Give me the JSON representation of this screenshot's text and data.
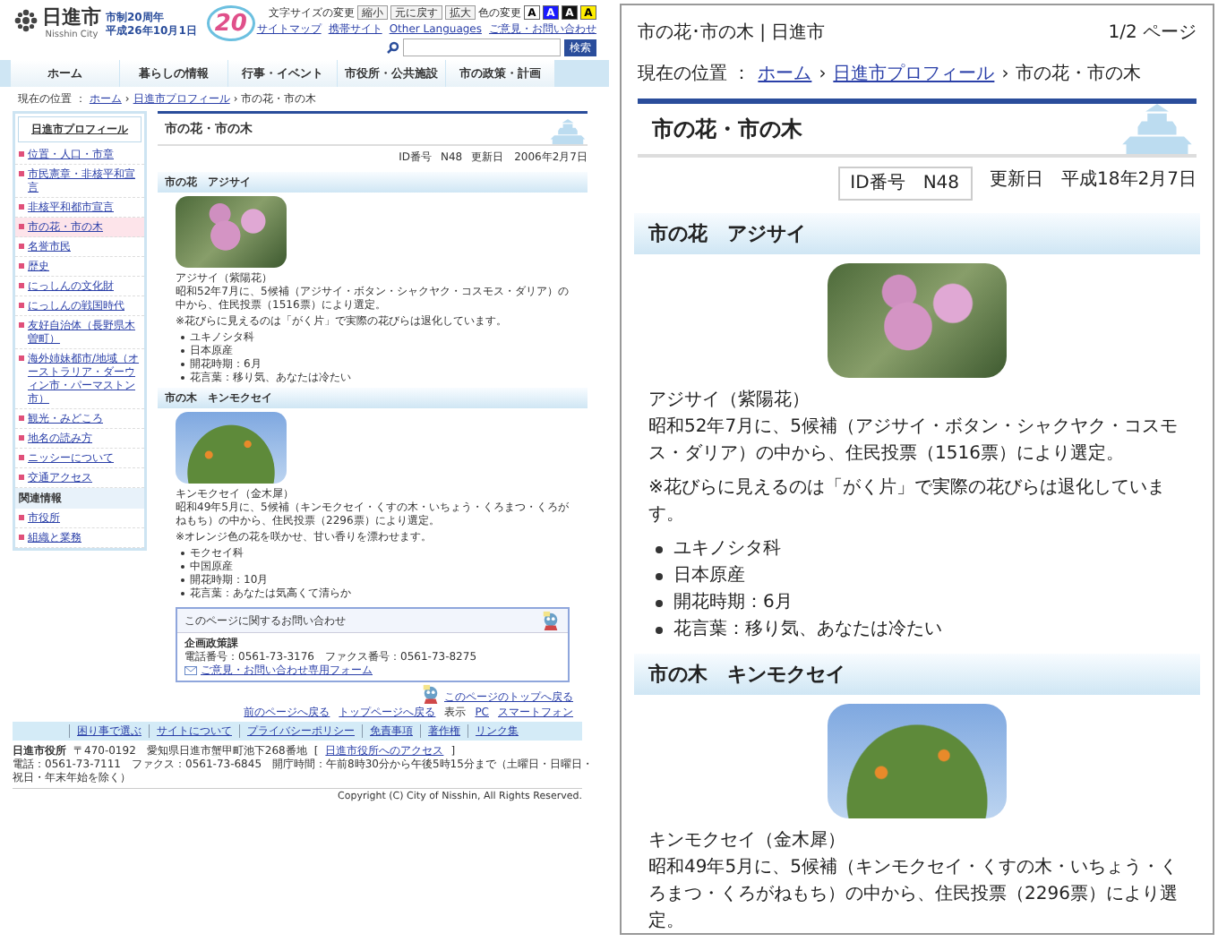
{
  "web_page": {
    "header": {
      "logo": "日進市",
      "logo_sub": "Nisshin City",
      "anniversary": [
        "市制20周年",
        "平成26年10月1日"
      ],
      "anniversary_mark": "20",
      "font_size_label": "文字サイズの変更",
      "font_size_buttons": [
        "縮小",
        "元に戻す",
        "拡大"
      ],
      "color_label": "色の変更",
      "color_buttons": [
        {
          "label": "A",
          "color": "#ffffff"
        },
        {
          "label": "A",
          "color": "#1a1aff"
        },
        {
          "label": "A",
          "color": "#111111"
        },
        {
          "label": "A",
          "color": "#ffee00"
        }
      ],
      "links": [
        "サイトマップ",
        "携帯サイト",
        "Other Languages",
        "ご意見・お問い合わせ"
      ],
      "search_button": "検索"
    },
    "nav": [
      "ホーム",
      "暮らしの情報",
      "行事・イベント",
      "市役所・公共施設",
      "市の政策・計画"
    ],
    "breadcrumb": {
      "label": "現在の位置 ：",
      "links": [
        "ホーム",
        "日進市プロフィール"
      ],
      "separator": "›",
      "current": "市の花・市の木"
    },
    "sidebar": {
      "title": "日進市プロフィール",
      "items": [
        {
          "label": "位置・人口・市章",
          "selected": false
        },
        {
          "label": "市民憲章・非核平和宣言",
          "selected": false
        },
        {
          "label": "非核平和都市宣言",
          "selected": false
        },
        {
          "label": "市の花・市の木",
          "selected": true
        },
        {
          "label": "名誉市民",
          "selected": false
        },
        {
          "label": "歴史",
          "selected": false
        },
        {
          "label": "にっしんの文化財",
          "selected": false
        },
        {
          "label": "にっしんの戦国時代",
          "selected": false
        },
        {
          "label": "友好自治体（長野県木曽町）",
          "selected": false
        },
        {
          "label": "海外姉妹都市/地域（オーストラリア・ダーウィン市・パーマストン市）",
          "selected": false
        },
        {
          "label": "観光・みどころ",
          "selected": false
        },
        {
          "label": "地名の読み方",
          "selected": false
        },
        {
          "label": "ニッシーについて",
          "selected": false
        },
        {
          "label": "交通アクセス",
          "selected": false
        }
      ],
      "related_title": "関連情報",
      "related_items": [
        "市役所",
        "組織と業務"
      ]
    },
    "article": {
      "title": "市の花・市の木",
      "id_label": "ID番号",
      "id": "N48",
      "updated_label": "更新日",
      "updated": "2006年2月7日",
      "sections": [
        {
          "heading": "市の花　アジサイ",
          "photo": {
            "kind": "flower"
          },
          "caption": "アジサイ（紫陽花）",
          "paragraph": "昭和52年7月に、5候補（アジサイ・ボタン・シャクヤク・コスモス・ダリア）の中から、住民投票（1516票）により選定。",
          "note": "※花びらに見えるのは「がく片」で実際の花びらは退化しています。",
          "bullets": [
            "ユキノシタ科",
            "日本原産",
            "開花時期：6月",
            "花言葉：移り気、あなたは冷たい"
          ]
        },
        {
          "heading": "市の木　キンモクセイ",
          "photo": {
            "kind": "tree"
          },
          "caption": "キンモクセイ（金木犀）",
          "paragraph": "昭和49年5月に、5候補（キンモクセイ・くすの木・いちょう・くろまつ・くろがねもち）の中から、住民投票（2296票）により選定。",
          "note": "※オレンジ色の花を咲かせ、甘い香りを漂わせます。",
          "bullets": [
            "モクセイ科",
            "中国原産",
            "開花時期：10月",
            "花言葉：あなたは気高くて清らか"
          ]
        }
      ]
    },
    "contact": {
      "title": "このページに関するお問い合わせ",
      "department": "企画政策課",
      "phone": "電話番号：0561-73-3176　ファクス番号：0561-73-8275",
      "form_link": "ご意見・お問い合わせ専用フォーム"
    },
    "page_top": "このページのトップへ戻る",
    "page_links": [
      "前のページへ戻る",
      "トップページへ戻る"
    ],
    "display_label": "表示",
    "display_options": [
      "PC",
      "スマートフォン"
    ],
    "footer_links": [
      "困り事で選ぶ",
      "サイトについて",
      "プライバシーポリシー",
      "免責事項",
      "著作権",
      "リンク集"
    ],
    "footer": {
      "office": "日進市役所",
      "address": "〒470-0192　愛知県日進市蟹甲町池下268番地",
      "access_brackets": [
        "[",
        "]"
      ],
      "access": "日進市役所へのアクセス",
      "contact": "電話：0561-73-7111　ファクス：0561-73-6845　開庁時間：午前8時30分から午後5時15分まで（土曜日・日曜日・祝日・年末年始を除く）",
      "copyright": "Copyright (C) City of Nisshin, All Rights Reserved."
    }
  },
  "print_preview": {
    "page_title": "市の花･市の木 | 日進市",
    "page_count": "1/2 ページ",
    "breadcrumb": {
      "label": "現在の位置 ：",
      "links": [
        "ホーム",
        "日進市プロフィール"
      ],
      "separator": "›",
      "current": "市の花・市の木"
    },
    "article": {
      "title": "市の花・市の木",
      "id_label": "ID番号",
      "id": "N48",
      "updated_label": "更新日",
      "updated": "平成18年2月7日",
      "sections": [
        {
          "heading": "市の花　アジサイ",
          "photo": {
            "kind": "flower"
          },
          "caption": "アジサイ（紫陽花）",
          "paragraph": "昭和52年7月に、5候補（アジサイ・ボタン・シャクヤク・コスモス・ダリア）の中から、住民投票（1516票）により選定。",
          "note": "※花びらに見えるのは「がく片」で実際の花びらは退化しています。",
          "bullets": [
            "ユキノシタ科",
            "日本原産",
            "開花時期：6月",
            "花言葉：移り気、あなたは冷たい"
          ]
        },
        {
          "heading": "市の木　キンモクセイ",
          "photo": {
            "kind": "tree"
          },
          "caption": "キンモクセイ（金木犀）",
          "paragraph": "昭和49年5月に、5候補（キンモクセイ・くすの木・いちょう・くろまつ・くろがねもち）の中から、住民投票（2296票）により選定。"
        }
      ]
    }
  }
}
